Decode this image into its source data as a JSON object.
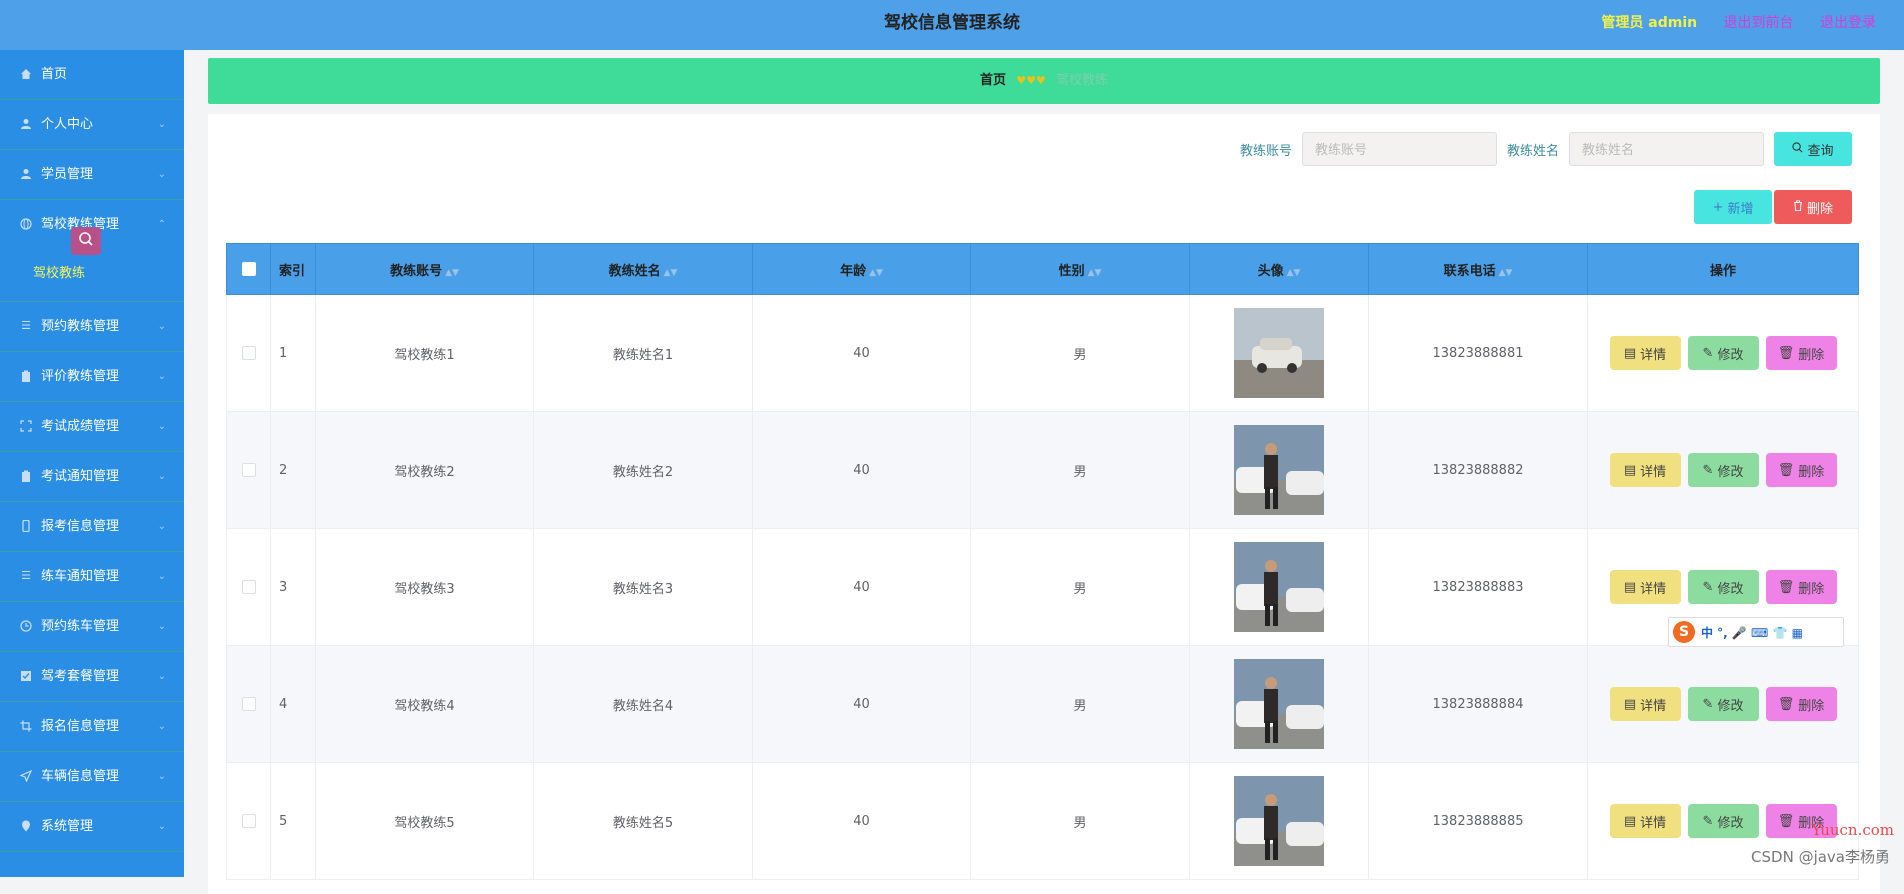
{
  "header": {
    "title": "驾校信息管理系统",
    "admin_label": "管理员 admin",
    "to_front_label": "退出到前台",
    "logout_label": "退出登录"
  },
  "sidebar": {
    "items": [
      {
        "label": "首页",
        "icon": "home-icon"
      },
      {
        "label": "个人中心",
        "icon": "user-icon"
      },
      {
        "label": "学员管理",
        "icon": "user-icon"
      },
      {
        "label": "驾校教练管理",
        "icon": "globe-icon",
        "sub": "驾校教练"
      },
      {
        "label": "预约教练管理",
        "icon": "list-icon"
      },
      {
        "label": "评价教练管理",
        "icon": "clipboard-icon"
      },
      {
        "label": "考试成绩管理",
        "icon": "frame-icon"
      },
      {
        "label": "考试通知管理",
        "icon": "clipboard-icon"
      },
      {
        "label": "报考信息管理",
        "icon": "phone-icon"
      },
      {
        "label": "练车通知管理",
        "icon": "list-icon"
      },
      {
        "label": "预约练车管理",
        "icon": "clock-icon"
      },
      {
        "label": "驾考套餐管理",
        "icon": "check-icon"
      },
      {
        "label": "报名信息管理",
        "icon": "crop-icon"
      },
      {
        "label": "车辆信息管理",
        "icon": "send-icon"
      },
      {
        "label": "系统管理",
        "icon": "location-icon"
      }
    ]
  },
  "breadcrumb": {
    "home": "首页",
    "separator": "♥♥♥",
    "current": "驾校教练"
  },
  "search": {
    "account_label": "教练账号",
    "account_placeholder": "教练账号",
    "name_label": "教练姓名",
    "name_placeholder": "教练姓名",
    "query_label": "查询"
  },
  "actions": {
    "add_label": "新增",
    "delete_label": "删除"
  },
  "table": {
    "headers": {
      "index": "索引",
      "account": "教练账号",
      "name": "教练姓名",
      "age": "年龄",
      "gender": "性别",
      "avatar": "头像",
      "phone": "联系电话",
      "ops": "操作"
    },
    "op_labels": {
      "detail": "详情",
      "edit": "修改",
      "remove": "删除"
    },
    "rows": [
      {
        "index": "1",
        "account": "驾校教练1",
        "name": "教练姓名1",
        "age": "40",
        "gender": "男",
        "phone": "13823888881"
      },
      {
        "index": "2",
        "account": "驾校教练2",
        "name": "教练姓名2",
        "age": "40",
        "gender": "男",
        "phone": "13823888882"
      },
      {
        "index": "3",
        "account": "驾校教练3",
        "name": "教练姓名3",
        "age": "40",
        "gender": "男",
        "phone": "13823888883"
      },
      {
        "index": "4",
        "account": "驾校教练4",
        "name": "教练姓名4",
        "age": "40",
        "gender": "男",
        "phone": "13823888884"
      },
      {
        "index": "5",
        "account": "驾校教练5",
        "name": "教练姓名5",
        "age": "40",
        "gender": "男",
        "phone": "13823888885"
      }
    ]
  },
  "ime": {
    "logo": "S",
    "text": "中 °, 🎤 ⌨ 👕 ▦"
  },
  "watermarks": {
    "site": "Yuucn.com",
    "author": "CSDN @java李杨勇"
  },
  "colors": {
    "topbar": "#4ea1e8",
    "sidebar": "#2b8ee5",
    "breadcrumb": "#3fdb98",
    "table_header": "#4aa0e8"
  }
}
